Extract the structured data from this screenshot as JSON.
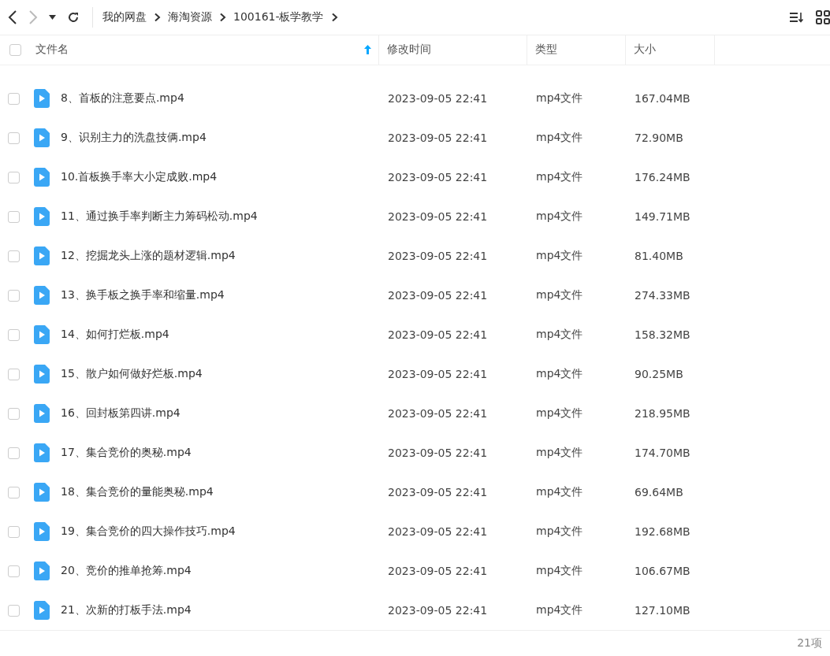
{
  "breadcrumb": [
    "我的网盘",
    "海淘资源",
    "100161-板学教学"
  ],
  "table": {
    "columns": [
      {
        "label": "文件名",
        "sorted": true
      },
      {
        "label": "修改时间",
        "sorted": false
      },
      {
        "label": "类型",
        "sorted": false
      },
      {
        "label": "大小",
        "sorted": false
      }
    ],
    "select_all": {
      "checked": false
    },
    "rows": [
      {
        "name": "8、首板的注意要点.mp4",
        "modified": "2023-09-05 22:41",
        "type": "mp4文件",
        "size": "167.04MB",
        "checked": false
      },
      {
        "name": "9、识别主力的洗盘技俩.mp4",
        "modified": "2023-09-05 22:41",
        "type": "mp4文件",
        "size": "72.90MB",
        "checked": false
      },
      {
        "name": "10.首板换手率大小定成败.mp4",
        "modified": "2023-09-05 22:41",
        "type": "mp4文件",
        "size": "176.24MB",
        "checked": false
      },
      {
        "name": "11、通过换手率判断主力筹码松动.mp4",
        "modified": "2023-09-05 22:41",
        "type": "mp4文件",
        "size": "149.71MB",
        "checked": false
      },
      {
        "name": "12、挖掘龙头上涨的题材逻辑.mp4",
        "modified": "2023-09-05 22:41",
        "type": "mp4文件",
        "size": "81.40MB",
        "checked": false
      },
      {
        "name": "13、换手板之换手率和缩量.mp4",
        "modified": "2023-09-05 22:41",
        "type": "mp4文件",
        "size": "274.33MB",
        "checked": false
      },
      {
        "name": "14、如何打烂板.mp4",
        "modified": "2023-09-05 22:41",
        "type": "mp4文件",
        "size": "158.32MB",
        "checked": false
      },
      {
        "name": "15、散户如何做好烂板.mp4",
        "modified": "2023-09-05 22:41",
        "type": "mp4文件",
        "size": "90.25MB",
        "checked": false
      },
      {
        "name": "16、回封板第四讲.mp4",
        "modified": "2023-09-05 22:41",
        "type": "mp4文件",
        "size": "218.95MB",
        "checked": false
      },
      {
        "name": "17、集合竞价的奥秘.mp4",
        "modified": "2023-09-05 22:41",
        "type": "mp4文件",
        "size": "174.70MB",
        "checked": false
      },
      {
        "name": "18、集合竞价的量能奥秘.mp4",
        "modified": "2023-09-05 22:41",
        "type": "mp4文件",
        "size": "69.64MB",
        "checked": false
      },
      {
        "name": "19、集合竞价的四大操作技巧.mp4",
        "modified": "2023-09-05 22:41",
        "type": "mp4文件",
        "size": "192.68MB",
        "checked": false
      },
      {
        "name": "20、竞价的推单抢筹.mp4",
        "modified": "2023-09-05 22:41",
        "type": "mp4文件",
        "size": "106.67MB",
        "checked": false
      },
      {
        "name": "21、次新的打板手法.mp4",
        "modified": "2023-09-05 22:41",
        "type": "mp4文件",
        "size": "127.10MB",
        "checked": false
      }
    ]
  },
  "status_bar": {
    "count": "21项"
  }
}
